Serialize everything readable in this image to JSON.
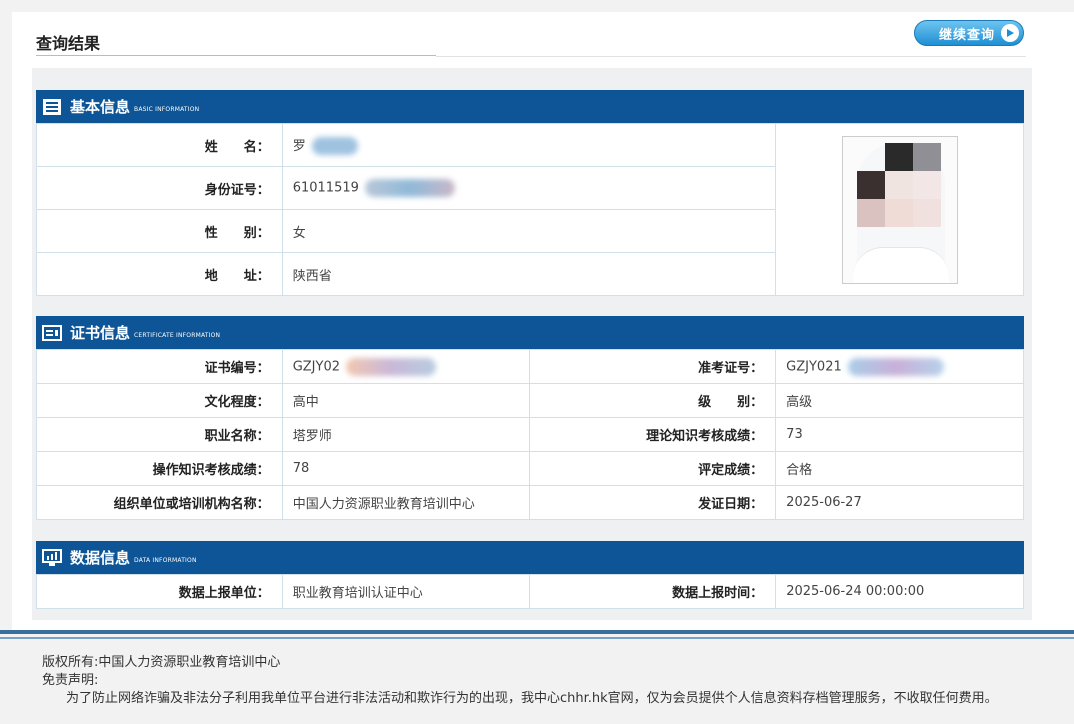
{
  "page": {
    "title": "查询结果",
    "continue_button": "继续查询"
  },
  "basic": {
    "title": "基本信息",
    "subtitle": "BASIC INFORMATION",
    "fields": [
      {
        "label": "姓　　名：",
        "value": "罗"
      },
      {
        "label": "身份证号：",
        "value": "61011519"
      },
      {
        "label": "性　　别：",
        "value": "女"
      },
      {
        "label": "地　　址：",
        "value": "陕西省"
      }
    ]
  },
  "certificate": {
    "title": "证书信息",
    "subtitle": "CERTIFICATE INFORMATION",
    "rows": [
      {
        "l1": "证书编号：",
        "v1": "GZJY02",
        "l2": "准考证号：",
        "v2": "GZJY021"
      },
      {
        "l1": "文化程度：",
        "v1": "高中",
        "l2": "级　　别：",
        "v2": "高级"
      },
      {
        "l1": "职业名称：",
        "v1": "塔罗师",
        "l2": "理论知识考核成绩：",
        "v2": "73"
      },
      {
        "l1": "操作知识考核成绩：",
        "v1": "78",
        "l2": "评定成绩：",
        "v2": "合格"
      },
      {
        "l1": "组织单位或培训机构名称：",
        "v1": "中国人力资源职业教育培训中心",
        "l2": "发证日期：",
        "v2": "2025-06-27"
      }
    ]
  },
  "data_info": {
    "title": "数据信息",
    "subtitle": "DATA INFORMATION",
    "l1": "数据上报单位：",
    "v1": "职业教育培训认证中心",
    "l2": "数据上报时间：",
    "v2": "2025-06-24 00:00:00"
  },
  "footer": {
    "copyright": "版权所有:中国人力资源职业教育培训中心",
    "disclaimer_title": "免责声明:",
    "disclaimer_text": "为了防止网络诈骗及非法分子利用我单位平台进行非法活动和欺诈行为的出现，我中心chhr.hk官网，仅为会员提供个人信息资料存档管理服务，不收取任何费用。"
  },
  "colors": {
    "header_blue": "#0d5596",
    "button_blue": "#1f8fd3",
    "border": "#cfe0e8"
  },
  "icons": {
    "basic": "list-icon",
    "certificate": "certificate-icon",
    "data": "monitor-chart-icon",
    "continue": "play-icon"
  }
}
